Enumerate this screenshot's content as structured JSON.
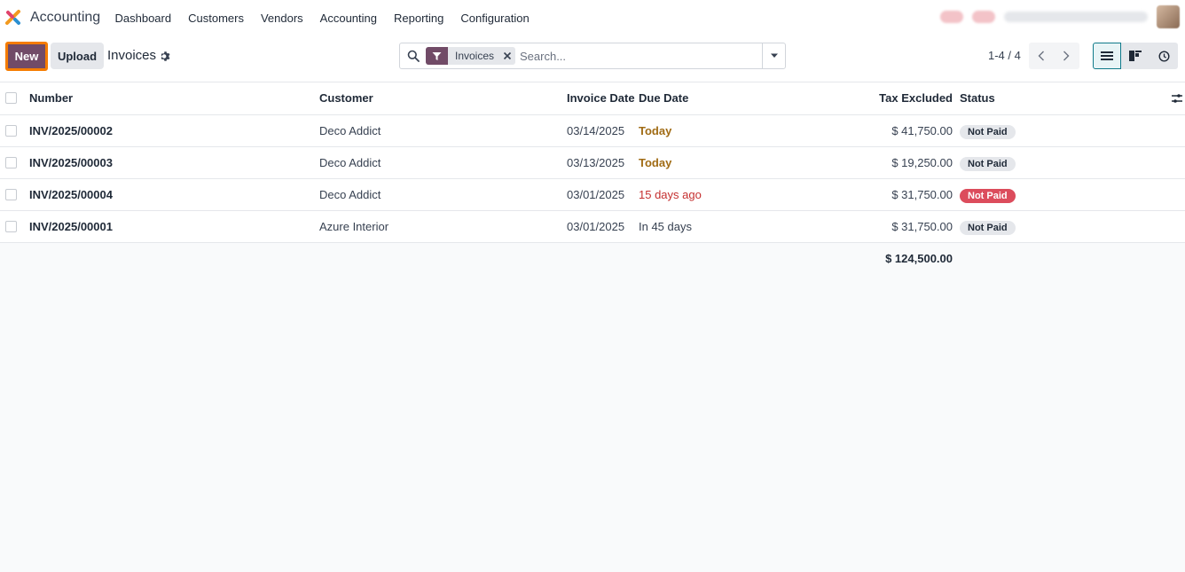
{
  "app": {
    "name": "Accounting"
  },
  "nav": {
    "items": [
      "Dashboard",
      "Customers",
      "Vendors",
      "Accounting",
      "Reporting",
      "Configuration"
    ]
  },
  "toolbar": {
    "new_label": "New",
    "upload_label": "Upload",
    "title": "Invoices"
  },
  "search": {
    "facet_label": "Invoices",
    "placeholder": "Search..."
  },
  "pager": {
    "value": "1-4 / 4"
  },
  "table": {
    "columns": {
      "number": "Number",
      "customer": "Customer",
      "invoice_date": "Invoice Date",
      "due_date": "Due Date",
      "tax_excluded": "Tax Excluded",
      "status": "Status"
    },
    "rows": [
      {
        "number": "INV/2025/00002",
        "customer": "Deco Addict",
        "invoice_date": "03/14/2025",
        "due_date": "Today",
        "due_state": "today",
        "tax_excluded": "$ 41,750.00",
        "status": "Not Paid",
        "status_state": "neutral"
      },
      {
        "number": "INV/2025/00003",
        "customer": "Deco Addict",
        "invoice_date": "03/13/2025",
        "due_date": "Today",
        "due_state": "today",
        "tax_excluded": "$ 19,250.00",
        "status": "Not Paid",
        "status_state": "neutral"
      },
      {
        "number": "INV/2025/00004",
        "customer": "Deco Addict",
        "invoice_date": "03/01/2025",
        "due_date": "15 days ago",
        "due_state": "late",
        "tax_excluded": "$ 31,750.00",
        "status": "Not Paid",
        "status_state": "danger"
      },
      {
        "number": "INV/2025/00001",
        "customer": "Azure Interior",
        "invoice_date": "03/01/2025",
        "due_date": "In 45 days",
        "due_state": "normal",
        "tax_excluded": "$ 31,750.00",
        "status": "Not Paid",
        "status_state": "neutral"
      }
    ],
    "total": "$ 124,500.00"
  },
  "colors": {
    "brand": "#714b67",
    "highlight": "#f57c00",
    "due_today": "#a06b14",
    "due_late": "#c53030",
    "danger_badge": "#dc4c5c"
  }
}
